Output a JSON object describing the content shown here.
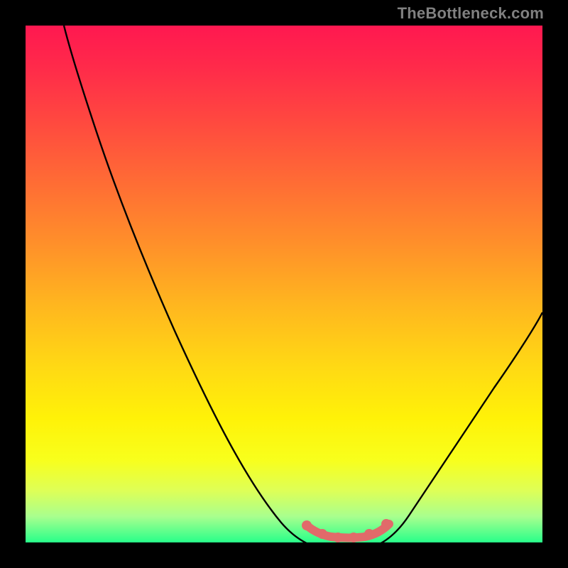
{
  "watermark": "TheBottleneck.com",
  "chart_data": {
    "type": "line",
    "title": "",
    "xlabel": "",
    "ylabel": "",
    "xlim": [
      0,
      100
    ],
    "ylim": [
      0,
      100
    ],
    "grid": false,
    "legend": false,
    "background_gradient": {
      "top": "#ff1850",
      "middle": "#ffd914",
      "bottom": "#28ff8a"
    },
    "series": [
      {
        "name": "bottleneck-curve",
        "color": "#000000",
        "x": [
          8,
          12,
          16,
          20,
          24,
          28,
          32,
          36,
          40,
          44,
          48,
          52,
          55,
          58,
          61,
          64,
          67,
          70,
          74,
          78,
          82,
          86,
          90,
          94,
          98,
          100
        ],
        "y": [
          100,
          96,
          90,
          83,
          75,
          67,
          59,
          51,
          43,
          35,
          27,
          19,
          12,
          7,
          3,
          1,
          0,
          1,
          4,
          9,
          16,
          25,
          34,
          43,
          50,
          53
        ]
      },
      {
        "name": "optimal-plateau",
        "color": "#e16a6a",
        "x": [
          55,
          58,
          61,
          64,
          67,
          70
        ],
        "y": [
          3,
          1.5,
          0.8,
          0.5,
          0.8,
          2
        ]
      }
    ]
  }
}
